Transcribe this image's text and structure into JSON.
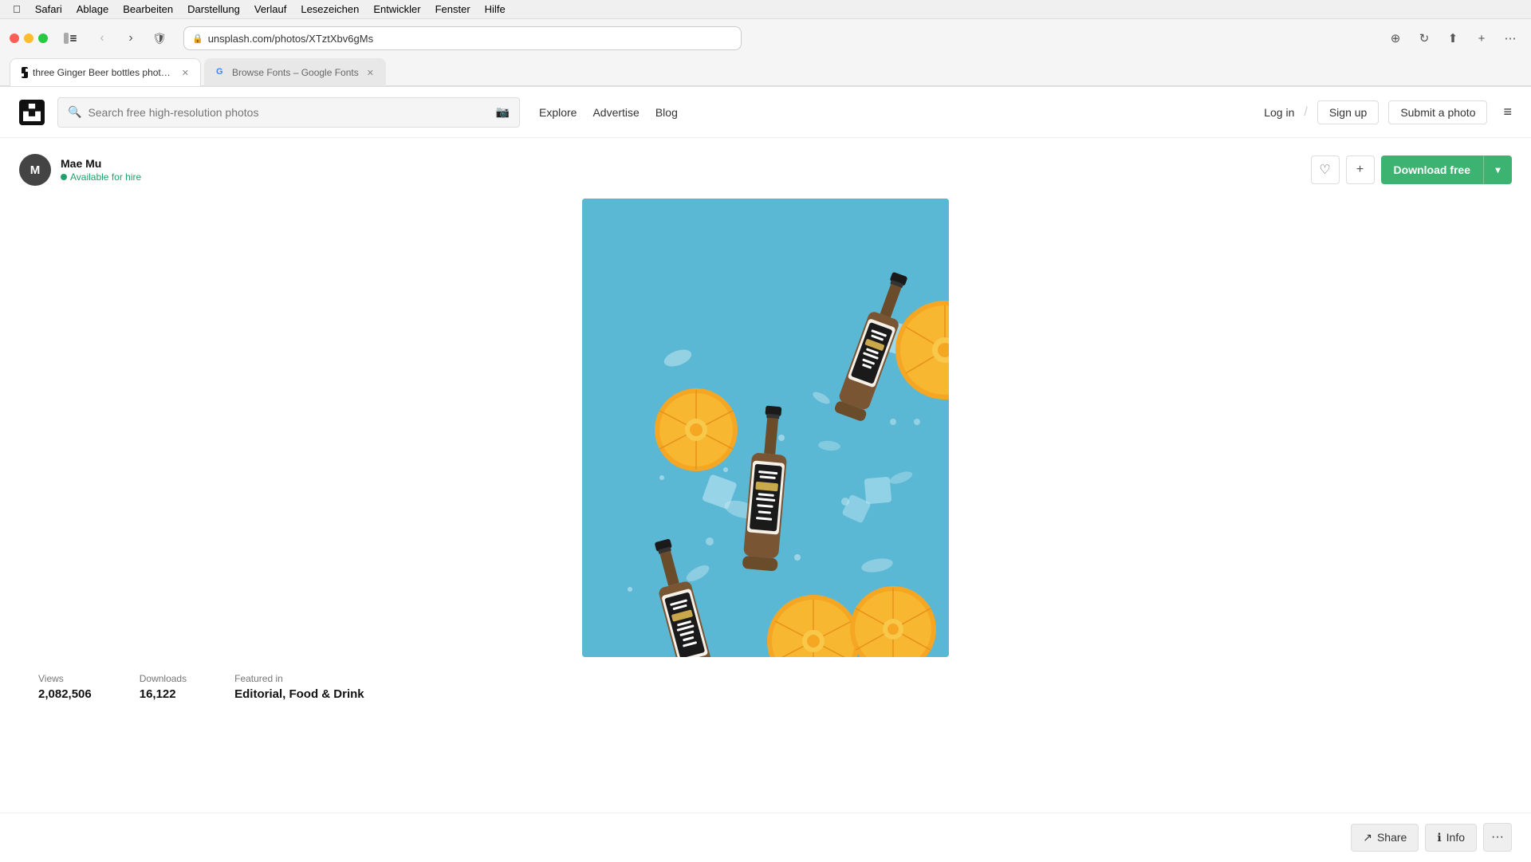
{
  "browser": {
    "url": "unsplash.com/photos/XTztXbv6gMs",
    "tab1": {
      "label": "three Ginger Beer bottles photo – Free Food Image on Unsplash",
      "favicon": "📷"
    },
    "tab2": {
      "label": "Browse Fonts – Google Fonts",
      "favicon": "G"
    }
  },
  "macos_menu": {
    "apple": "🍎",
    "items": [
      "Safari",
      "Ablage",
      "Bearbeiten",
      "Darstellung",
      "Verlauf",
      "Lesezeichen",
      "Entwickler",
      "Fenster",
      "Hilfe"
    ]
  },
  "header": {
    "search_placeholder": "Search free high-resolution photos",
    "nav": [
      "Explore",
      "Advertise",
      "Blog"
    ],
    "login": "Log in",
    "divider": "/",
    "signup": "Sign up",
    "submit_photo": "Submit a photo",
    "download_free": "Download free"
  },
  "photographer": {
    "name": "Mae Mu",
    "available_label": "Available for hire",
    "initials": "M"
  },
  "stats": {
    "views_label": "Views",
    "views_value": "2,082,506",
    "downloads_label": "Downloads",
    "downloads_value": "16,122",
    "featured_label": "Featured in",
    "featured_value": "Editorial, Food & Drink"
  },
  "actions": {
    "share": "Share",
    "info": "Info",
    "more": "···"
  },
  "colors": {
    "download_green": "#3cb371",
    "available_green": "#22a06b",
    "photo_bg": "#5bb8d4"
  }
}
